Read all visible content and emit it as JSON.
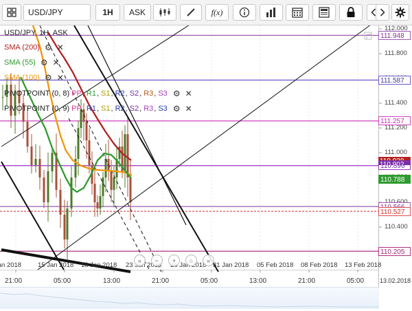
{
  "toolbar": {
    "symbol": "USD/JPY",
    "timeframe": "1H",
    "price_type": "ASK",
    "items": [
      {
        "name": "symbol-search-icon"
      },
      {
        "name": "candlestick-type-icon"
      },
      {
        "name": "draw-line-icon"
      },
      {
        "name": "function-icon",
        "label": "f(x)"
      },
      {
        "name": "info-icon"
      },
      {
        "name": "bar-chart-icon"
      },
      {
        "name": "calendar-icon"
      },
      {
        "name": "news-icon"
      },
      {
        "name": "lock-icon"
      },
      {
        "name": "chevron-left-icon"
      },
      {
        "name": "chevron-right-icon"
      },
      {
        "name": "gear-icon"
      }
    ]
  },
  "chart": {
    "title": "USD/JPY, 1H, ASK",
    "indicators": {
      "sma200": {
        "label": "SMA (200)",
        "color": "#b22222"
      },
      "sma55": {
        "label": "SMA (55)",
        "color": "#2e9b2e"
      },
      "sma100": {
        "label": "SMA (100)",
        "color": "#f0960a"
      },
      "pivot1": {
        "label": "PIVOTPOINT (0, 8)",
        "levels": [
          {
            "t": "PP",
            "c": "#e0398f"
          },
          {
            "t": "R1",
            "c": "#2e9b2e"
          },
          {
            "t": "S1",
            "c": "#b5a000"
          },
          {
            "t": "R2",
            "c": "#2a3bb0"
          },
          {
            "t": "S2",
            "c": "#7a2ea8"
          },
          {
            "t": "R3",
            "c": "#b55a1a"
          },
          {
            "t": "S3",
            "c": "#a33fbf"
          }
        ]
      },
      "pivot2": {
        "label": "PIVOTPOINT (0, 9)",
        "levels": [
          {
            "t": "PP",
            "c": "#e0398f"
          },
          {
            "t": "R1",
            "c": "#2a3bb0"
          },
          {
            "t": "S1",
            "c": "#b5a000"
          },
          {
            "t": "R2",
            "c": "#2a3bb0"
          },
          {
            "t": "S2",
            "c": "#7a2ea8"
          },
          {
            "t": "R3",
            "c": "#a33fbf"
          },
          {
            "t": "S3",
            "c": "#2a3bb0"
          }
        ]
      }
    },
    "y_axis": [
      "112.000",
      "111.800",
      "111.600",
      "111.400",
      "111.200",
      "111.000",
      "110.800",
      "110.600",
      "110.400",
      "110.200"
    ],
    "price_labels": [
      {
        "value": "111.948",
        "bg": "#ffffff",
        "fg": "#8a2f8a",
        "line": "#9b59b6"
      },
      {
        "value": "111.587",
        "bg": "#ffffff",
        "fg": "#3a3aa0",
        "line": "#6a5acd"
      },
      {
        "value": "111.257",
        "bg": "#ffffff",
        "fg": "#c030b0",
        "line": "#d040c0"
      },
      {
        "value": "110.896",
        "bg": "#ffffff",
        "fg": "#6a2ca8",
        "line": "#9b30c8"
      },
      {
        "value": "110.788",
        "bg": "#2e9b2e",
        "fg": "#ffffff",
        "line": ""
      },
      {
        "value": "110.566",
        "bg": "#ffffff",
        "fg": "#8a2f8a",
        "line": "#9b59b6"
      },
      {
        "value": "110.527",
        "bg": "#ffffff",
        "fg": "#d0302b",
        "line": "#e05050"
      },
      {
        "value": "110.205",
        "bg": "#ffffff",
        "fg": "#a02878",
        "line": "#b03080"
      }
    ],
    "hidden_labels": [
      "110.928",
      "110.902"
    ],
    "x_dates": [
      "Jan 2018",
      "15 Jan 2018",
      "18 Jan 2018",
      "23 Jan 2018",
      "26 Jan 2018",
      "31 Jan 2018",
      "05 Feb 2018",
      "08 Feb 2018",
      "13 Feb 2018"
    ],
    "x_times": [
      "21:00",
      "05:00",
      "13:00",
      "21:00",
      "05:00",
      "13:00",
      "21:00",
      "05:00"
    ],
    "x_end_date": "13.02.2018"
  }
}
